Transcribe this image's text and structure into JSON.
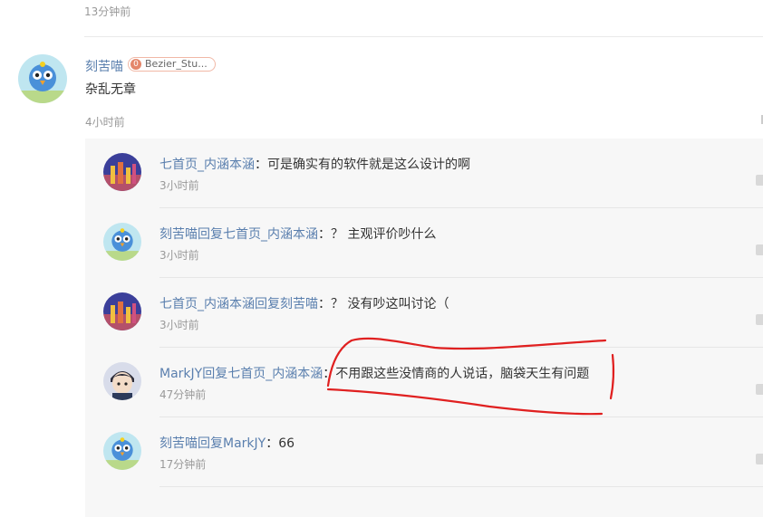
{
  "top": {
    "time": "13分钟前"
  },
  "main_comment": {
    "username": "刻苦喵",
    "badge_level": "0",
    "badge_text": "Bezier_Stu...",
    "text": "杂乱无章",
    "time": "4小时前"
  },
  "replies": [
    {
      "user": "七首页_内涵本涵",
      "reply_word": "",
      "target": "",
      "sep": "：",
      "text": "可是确实有的软件就是这么设计的啊",
      "time": "3小时前"
    },
    {
      "user": "刻苦喵",
      "reply_word": "回复",
      "target": "七首页_内涵本涵",
      "sep": "：",
      "text": "？ 主观评价吵什么",
      "time": "3小时前"
    },
    {
      "user": "七首页_内涵本涵",
      "reply_word": "回复",
      "target": "刻苦喵",
      "sep": "：",
      "text": "？ 没有吵这叫讨论（",
      "time": "3小时前"
    },
    {
      "user": "MarkJY",
      "reply_word": "回复",
      "target": "七首页_内涵本涵",
      "sep": "：",
      "text": "不用跟这些没情商的人说话，脑袋天生有问题",
      "time": "47分钟前"
    },
    {
      "user": "刻苦喵",
      "reply_word": "回复",
      "target": "MarkJY",
      "sep": "：",
      "text": "66",
      "time": "17分钟前"
    }
  ],
  "colors": {
    "link": "#5a7fae",
    "annotation": "#e02020",
    "reply_bg": "#f7f7f7"
  }
}
